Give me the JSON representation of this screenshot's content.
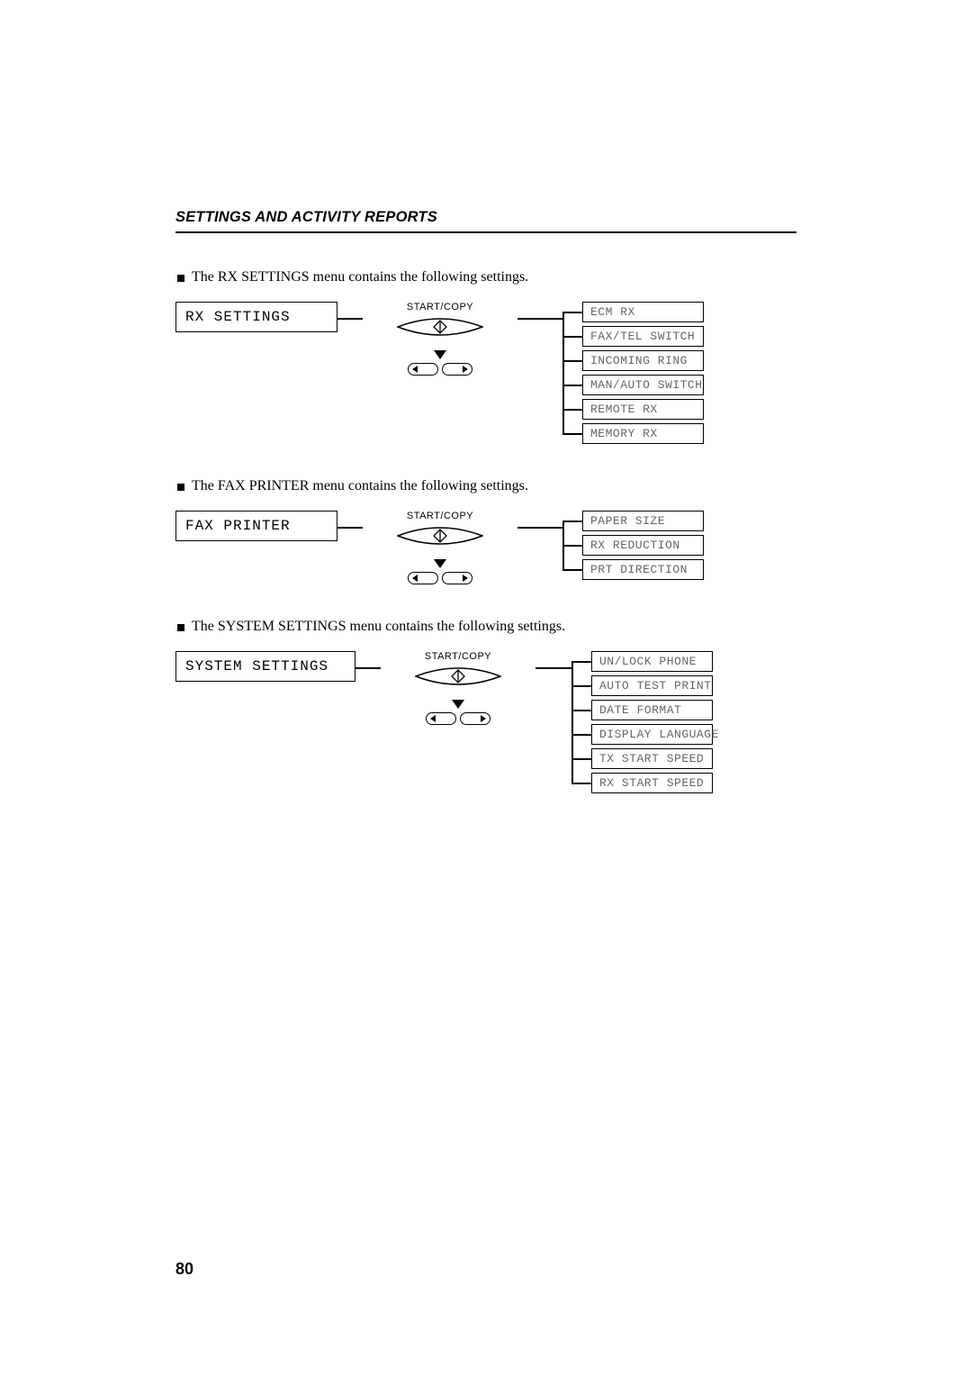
{
  "header": "SETTINGS AND ACTIVITY REPORTS",
  "page_number": "80",
  "start_copy_label": "START/COPY",
  "sections": [
    {
      "intro": "The RX SETTINGS menu contains the following settings.",
      "menu_label": "RX SETTINGS",
      "options": [
        "ECM RX",
        "FAX/TEL SWITCH",
        "INCOMING RING",
        "MAN/AUTO SWITCH",
        "REMOTE RX",
        "MEMORY RX"
      ]
    },
    {
      "intro": "The FAX PRINTER menu contains the following settings.",
      "menu_label": "FAX PRINTER",
      "options": [
        "PAPER SIZE",
        "RX REDUCTION",
        "PRT DIRECTION"
      ]
    },
    {
      "intro": "The SYSTEM SETTINGS menu contains the following settings.",
      "menu_label": "SYSTEM SETTINGS",
      "options": [
        "UN/LOCK PHONE",
        "AUTO TEST PRINT",
        "DATE FORMAT",
        "DISPLAY LANGUAGE",
        "TX START SPEED",
        "RX START SPEED"
      ]
    }
  ]
}
